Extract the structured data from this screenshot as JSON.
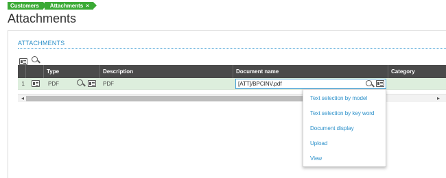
{
  "breadcrumb": {
    "items": [
      "Customers",
      "Attachments"
    ],
    "close_glyph": "×"
  },
  "page": {
    "title": "Attachments"
  },
  "section": {
    "title": "ATTACHMENTS"
  },
  "grid": {
    "columns": [
      "Type",
      "Description",
      "Document name",
      "Category"
    ],
    "rows": [
      {
        "num": "1",
        "type": "PDF",
        "description": "PDF",
        "document_name": "[ATT]/BPCINV.pdf",
        "category": ""
      }
    ]
  },
  "scroll": {
    "left_arrow": "◂",
    "right_arrow": "▸"
  },
  "menu": {
    "items": [
      "Text selection by model",
      "Text selection by key word",
      "Document display",
      "Upload",
      "View"
    ]
  },
  "colors": {
    "accent": "#2a8fc9",
    "breadcrumb": "#3aaa35",
    "header": "#4a4a4a",
    "selected_row": "#ddeedd"
  }
}
